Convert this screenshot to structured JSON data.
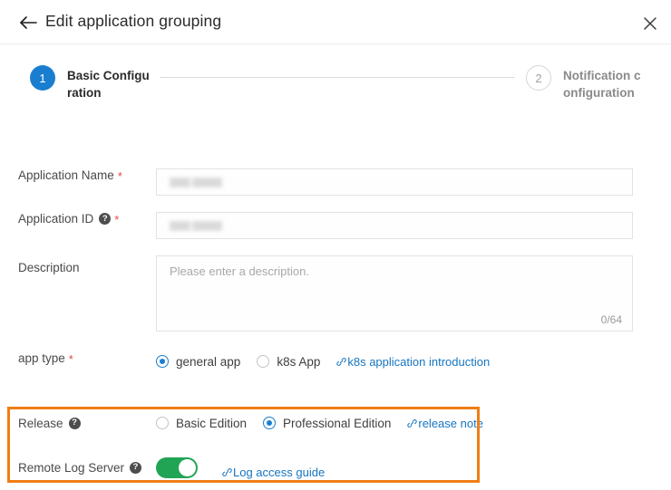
{
  "header": {
    "title": "Edit application grouping",
    "back_icon": "arrow-left-icon",
    "close_icon": "close-icon"
  },
  "stepper": {
    "steps": [
      {
        "number": "1",
        "label": "Basic Configuration",
        "state": "active"
      },
      {
        "number": "2",
        "label": "Notification configuration",
        "state": "inactive"
      }
    ]
  },
  "form": {
    "app_name": {
      "label": "Application Name",
      "required_mark": "*",
      "value": ""
    },
    "app_id": {
      "label": "Application ID",
      "required_mark": "*",
      "help_icon": "?",
      "value": ""
    },
    "description": {
      "label": "Description",
      "placeholder": "Please enter a description.",
      "counter": "0/64",
      "value": ""
    },
    "app_type": {
      "label": "app type",
      "required_mark": "*",
      "options": [
        {
          "label": "general app",
          "selected": true
        },
        {
          "label": "k8s App",
          "selected": false
        }
      ],
      "link": {
        "text": "k8s application introduction",
        "icon": "link-icon"
      }
    },
    "release": {
      "label": "Release",
      "help_icon": "?",
      "options": [
        {
          "label": "Basic Edition",
          "selected": false
        },
        {
          "label": "Professional Edition",
          "selected": true
        }
      ],
      "link": {
        "text": "release note",
        "icon": "link-icon"
      }
    },
    "remote_log_server": {
      "label": "Remote Log Server",
      "help_icon": "?",
      "toggle_on": true,
      "link": {
        "text": "Log access guide",
        "icon": "link-icon"
      }
    }
  },
  "annotations": {
    "highlight_color": "#f07d15"
  },
  "colors": {
    "accent_blue": "#1a7ed0",
    "link_blue": "#1675c0",
    "toggle_green": "#21a453",
    "required_red": "#e8493f"
  }
}
